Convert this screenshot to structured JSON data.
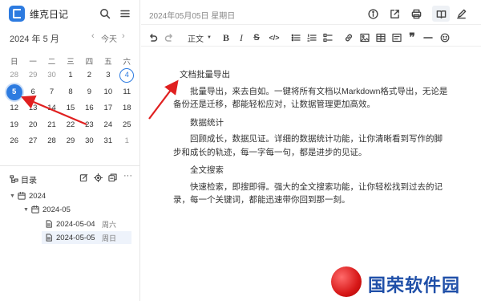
{
  "app": {
    "title": "维克日记"
  },
  "calendar": {
    "title": "2024 年 5 月",
    "today_label": "今天",
    "weekdays": [
      "日",
      "一",
      "二",
      "三",
      "四",
      "五",
      "六"
    ],
    "days": [
      {
        "d": "28",
        "muted": true
      },
      {
        "d": "29",
        "muted": true
      },
      {
        "d": "30",
        "muted": true
      },
      {
        "d": "1"
      },
      {
        "d": "2"
      },
      {
        "d": "3"
      },
      {
        "d": "4",
        "today": true
      },
      {
        "d": "5",
        "selected": true
      },
      {
        "d": "6"
      },
      {
        "d": "7"
      },
      {
        "d": "8"
      },
      {
        "d": "9"
      },
      {
        "d": "10"
      },
      {
        "d": "11"
      },
      {
        "d": "12"
      },
      {
        "d": "13"
      },
      {
        "d": "14"
      },
      {
        "d": "15"
      },
      {
        "d": "16"
      },
      {
        "d": "17"
      },
      {
        "d": "18"
      },
      {
        "d": "19"
      },
      {
        "d": "20"
      },
      {
        "d": "21"
      },
      {
        "d": "22"
      },
      {
        "d": "23"
      },
      {
        "d": "24"
      },
      {
        "d": "25"
      },
      {
        "d": "26"
      },
      {
        "d": "27"
      },
      {
        "d": "28"
      },
      {
        "d": "29"
      },
      {
        "d": "30"
      },
      {
        "d": "31"
      },
      {
        "d": "1",
        "muted": true
      }
    ]
  },
  "tree": {
    "title": "目录",
    "year": "2024",
    "month": "2024-05",
    "entries": [
      {
        "date": "2024-05-04",
        "weekday": "周六"
      },
      {
        "date": "2024-05-05",
        "weekday": "周日",
        "active": true
      }
    ]
  },
  "editor": {
    "date_title": "2024年05月05日 星期日",
    "style_label": "正文",
    "heading": "文档批量导出",
    "para1": "批量导出，来去自如。一键将所有文档以Markdown格式导出，无论是备份还是迁移，都能轻松应对，让数据管理更加高效。",
    "sub1": "数据统计",
    "para2": "回顾成长，数据见证。详细的数据统计功能，让你清晰看到写作的脚步和成长的轨迹，每一字每一句，都是进步的见证。",
    "sub2": "全文搜索",
    "para3": "快速检索，即搜即得。强大的全文搜索功能，让你轻松找到过去的记录，每一个关键词，都能迅速带你回到那一刻。"
  },
  "watermark": {
    "text": "国荣软件园"
  },
  "colors": {
    "accent": "#2d7be0",
    "arrow": "#e02020"
  }
}
